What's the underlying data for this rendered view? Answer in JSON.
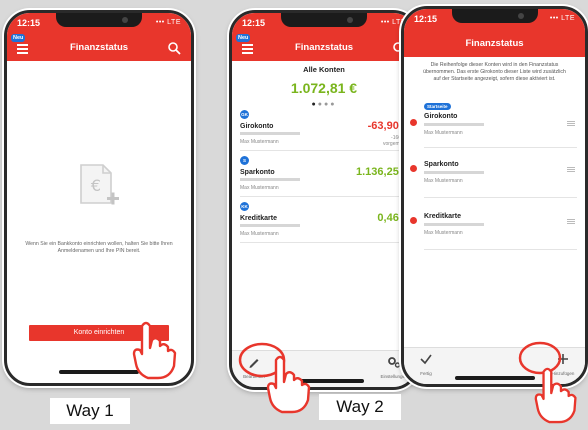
{
  "brand_color": "#e8362c",
  "accent_blue": "#1f72d8",
  "positive_color": "#7ab51d",
  "phones": {
    "p1": {
      "time": "12:15",
      "signal": "••• LTE",
      "badge": "Neu",
      "title": "Finanzstatus",
      "empty_text": "Wenn Sie ein Bankkonto einrichten wollen, halten Sie bitte Ihren Anmeldenamen und Ihre PIN bereit.",
      "button_label": "Konto einrichten",
      "footer": "Way 1"
    },
    "p2": {
      "time": "12:15",
      "signal": "••• LTE",
      "badge": "Neu",
      "title": "Finanzstatus",
      "total_label": "Alle Konten",
      "total_amount": "1.072,81 €",
      "accounts": [
        {
          "badge": "GK",
          "name": "Girokonto",
          "holder": "Max Mustermann",
          "amount": "-63,90 €",
          "extra1": "-166,92",
          "extra2": "vorgemerkt"
        },
        {
          "badge": "S",
          "name": "Sparkonto",
          "holder": "Max Mustermann",
          "amount": "1.136,25 €"
        },
        {
          "badge": "KK",
          "name": "Kreditkarte",
          "holder": "Max Mustermann",
          "amount": "0,46 €"
        }
      ],
      "tabs": {
        "left": "Bearbeiten",
        "right": "Einstellungen"
      },
      "footer": "Way 2"
    },
    "p3": {
      "time": "12:15",
      "signal": "••• LTE",
      "title": "Finanzstatus",
      "info_text": "Die Reihenfolge dieser Konten wird in den Finanzstatus übernommen. Das erste Girokonto dieser Liste wird zusätzlich auf der Startseite angezeigt, sofern diese aktiviert ist.",
      "startseite": "Startseite",
      "accounts": [
        {
          "name": "Girokonto",
          "holder": "Max Mustermann"
        },
        {
          "name": "Sparkonto",
          "holder": "Max Mustermann"
        },
        {
          "name": "Kreditkarte",
          "holder": "Max Mustermann"
        }
      ],
      "tabs": {
        "left": "Fertig",
        "right": "Hinzufügen"
      }
    }
  }
}
